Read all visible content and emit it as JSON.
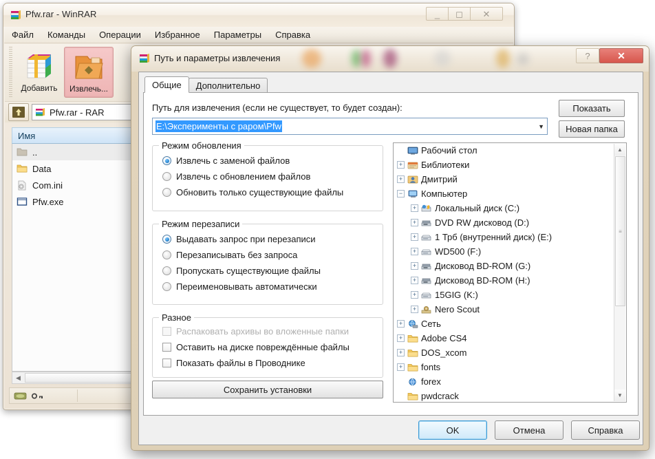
{
  "main_window": {
    "title": "Pfw.rar - WinRAR",
    "icon": "winrar-books-icon",
    "controls": {
      "minimize": "minimize-icon",
      "maximize": "maximize-icon",
      "close": "close-icon"
    },
    "menu": [
      "Файл",
      "Команды",
      "Операции",
      "Избранное",
      "Параметры",
      "Справка"
    ],
    "toolbar": [
      {
        "label": "Добавить",
        "icon": "add-archive-icon",
        "active": false
      },
      {
        "label": "Извлечь...",
        "icon": "extract-folder-icon",
        "active": true
      }
    ],
    "address_bar": {
      "up_button": "up-folder-icon",
      "value": "Pfw.rar - RAR",
      "icon": "winrar-books-icon"
    },
    "list_header": [
      "Имя"
    ],
    "files": [
      {
        "name": "..",
        "icon": "parent-folder-icon",
        "selected": true
      },
      {
        "name": "Data",
        "icon": "folder-icon",
        "selected": false
      },
      {
        "name": "Com.ini",
        "icon": "ini-file-icon",
        "selected": false
      },
      {
        "name": "Pfw.exe",
        "icon": "exe-file-icon",
        "selected": false
      }
    ],
    "status": {
      "disk_icon": "disk-icon",
      "key_icon": "key-icon"
    }
  },
  "dialog": {
    "title": "Путь и параметры извлечения",
    "icon": "winrar-books-icon",
    "help_button": "?",
    "close_button": "✕",
    "tabs": [
      {
        "label": "Общие",
        "active": true
      },
      {
        "label": "Дополнительно",
        "active": false
      }
    ],
    "path": {
      "label": "Путь для извлечения (если не существует, то будет создан):",
      "value": "E:\\Эксперименты с раром\\Pfw",
      "dropdown_icon": "chevron-down-icon"
    },
    "buttons": {
      "show": "Показать",
      "new_folder": "Новая папка",
      "save_settings": "Сохранить установки",
      "ok": "OK",
      "cancel": "Отмена",
      "help": "Справка"
    },
    "update_mode": {
      "title": "Режим обновления",
      "options": [
        {
          "label": "Извлечь с заменой файлов",
          "selected": true
        },
        {
          "label": "Извлечь с обновлением файлов",
          "selected": false
        },
        {
          "label": "Обновить только существующие файлы",
          "selected": false
        }
      ]
    },
    "overwrite_mode": {
      "title": "Режим перезаписи",
      "options": [
        {
          "label": "Выдавать запрос при перезаписи",
          "selected": true
        },
        {
          "label": "Перезаписывать без запроса",
          "selected": false
        },
        {
          "label": "Пропускать существующие файлы",
          "selected": false
        },
        {
          "label": "Переименовывать автоматически",
          "selected": false
        }
      ]
    },
    "misc": {
      "title": "Разное",
      "options": [
        {
          "label": "Распаковать архивы во вложенные папки",
          "checked": false,
          "disabled": true
        },
        {
          "label": "Оставить на диске повреждённые файлы",
          "checked": false,
          "disabled": false
        },
        {
          "label": "Показать файлы в Проводнике",
          "checked": false,
          "disabled": false
        }
      ]
    },
    "tree": {
      "nodes": [
        {
          "label": "Рабочий стол",
          "indent": 0,
          "toggle": "none",
          "icon": "desktop-icon"
        },
        {
          "label": "Библиотеки",
          "indent": 1,
          "toggle": "+",
          "icon": "libraries-icon"
        },
        {
          "label": "Дмитрий",
          "indent": 1,
          "toggle": "+",
          "icon": "user-icon"
        },
        {
          "label": "Компьютер",
          "indent": 1,
          "toggle": "-",
          "icon": "computer-icon"
        },
        {
          "label": "Локальный диск (C:)",
          "indent": 2,
          "toggle": "+",
          "icon": "system-drive-icon"
        },
        {
          "label": "DVD RW дисковод (D:)",
          "indent": 2,
          "toggle": "+",
          "icon": "optical-drive-icon"
        },
        {
          "label": "1 Трб (внутренний диск) (E:)",
          "indent": 2,
          "toggle": "+",
          "icon": "hard-drive-icon"
        },
        {
          "label": "WD500 (F:)",
          "indent": 2,
          "toggle": "+",
          "icon": "hard-drive-icon"
        },
        {
          "label": "Дисковод BD-ROM (G:)",
          "indent": 2,
          "toggle": "+",
          "icon": "optical-drive-icon"
        },
        {
          "label": "Дисковод BD-ROM (H:)",
          "indent": 2,
          "toggle": "+",
          "icon": "optical-drive-icon"
        },
        {
          "label": "15GIG (K:)",
          "indent": 2,
          "toggle": "+",
          "icon": "hard-drive-icon"
        },
        {
          "label": "Nero Scout",
          "indent": 2,
          "toggle": "+",
          "icon": "nero-scout-icon"
        },
        {
          "label": "Сеть",
          "indent": 1,
          "toggle": "+",
          "icon": "network-icon"
        },
        {
          "label": "Adobe CS4",
          "indent": 1,
          "toggle": "+",
          "icon": "folder-icon"
        },
        {
          "label": "DOS_xcom",
          "indent": 1,
          "toggle": "+",
          "icon": "folder-icon"
        },
        {
          "label": "fonts",
          "indent": 1,
          "toggle": "+",
          "icon": "folder-icon"
        },
        {
          "label": "forex",
          "indent": 1,
          "toggle": "none",
          "icon": "globe-folder-icon"
        },
        {
          "label": "pwdcrack",
          "indent": 1,
          "toggle": "none",
          "icon": "folder-icon"
        }
      ],
      "scrollbar": {
        "up_arrow": "scroll-up-icon",
        "down_arrow": "scroll-down-icon"
      }
    }
  },
  "colors": {
    "selection_blue": "#3399ff",
    "aero_frame": "#e3d5bd",
    "close_red": "#d7564c",
    "default_button_glow": "#3c9ad6"
  }
}
